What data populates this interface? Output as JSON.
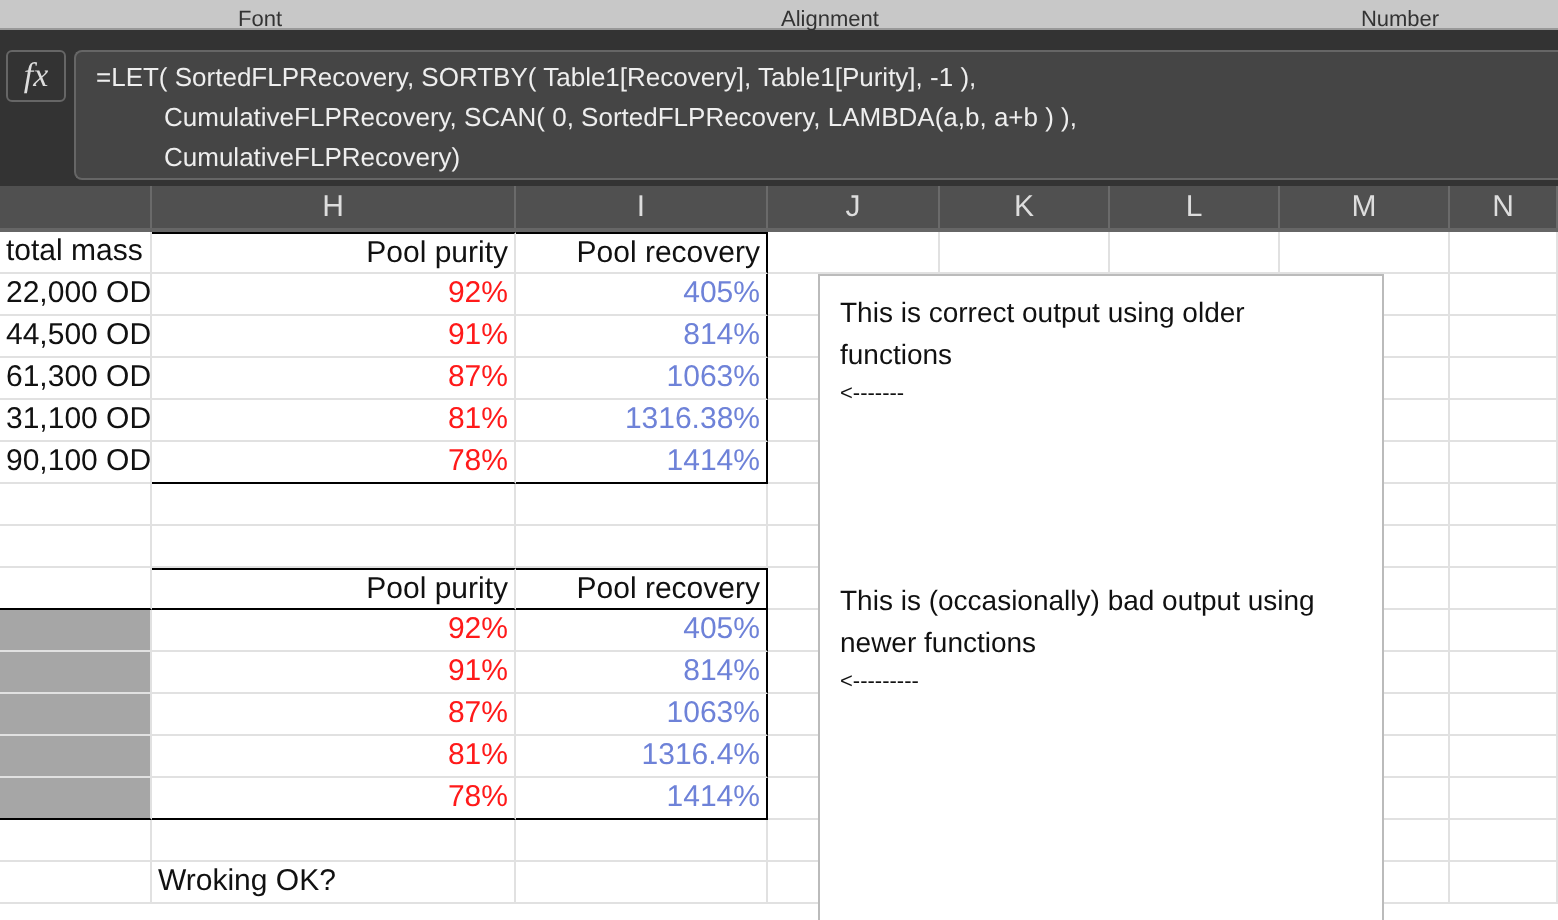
{
  "ribbon_groups": [
    "Font",
    "Alignment",
    "Number"
  ],
  "formula_bar": {
    "function_label": "fx",
    "lines": [
      "=LET( SortedFLPRecovery, SORTBY( Table1[Recovery], Table1[Purity], -1 ),",
      "CumulativeFLPRecovery, SCAN( 0, SortedFLPRecovery, LAMBDA(a,b, a+b ) ),",
      "CumulativeFLPRecovery)"
    ]
  },
  "column_headers": [
    "H",
    "I",
    "J",
    "K",
    "L",
    "M",
    "N"
  ],
  "table_1": {
    "columns": [
      "total mass",
      "Pool purity",
      "Pool recovery"
    ],
    "rows": [
      {
        "mass": "22,000 OD",
        "purity": "92%",
        "recovery": "405%"
      },
      {
        "mass": "44,500 OD",
        "purity": "91%",
        "recovery": "814%"
      },
      {
        "mass": "61,300 OD",
        "purity": "87%",
        "recovery": "1063%"
      },
      {
        "mass": "31,100 OD",
        "purity": "81%",
        "recovery": "1316.38%"
      },
      {
        "mass": "90,100 OD",
        "purity": "78%",
        "recovery": "1414%"
      }
    ]
  },
  "table_2": {
    "columns": [
      "Pool purity",
      "Pool recovery"
    ],
    "rows": [
      {
        "purity": "92%",
        "recovery": "405%"
      },
      {
        "purity": "91%",
        "recovery": "814%"
      },
      {
        "purity": "87%",
        "recovery": "1063%"
      },
      {
        "purity": "81%",
        "recovery": "1316.4%"
      },
      {
        "purity": "78%",
        "recovery": "1414%"
      }
    ]
  },
  "status_note": "Wroking OK?",
  "text_box": {
    "notes": [
      {
        "text": "This is correct output using older functions",
        "arrow": "<-------"
      },
      {
        "text": "This is (occasionally) bad output using newer functions",
        "arrow": "<---------"
      }
    ]
  }
}
